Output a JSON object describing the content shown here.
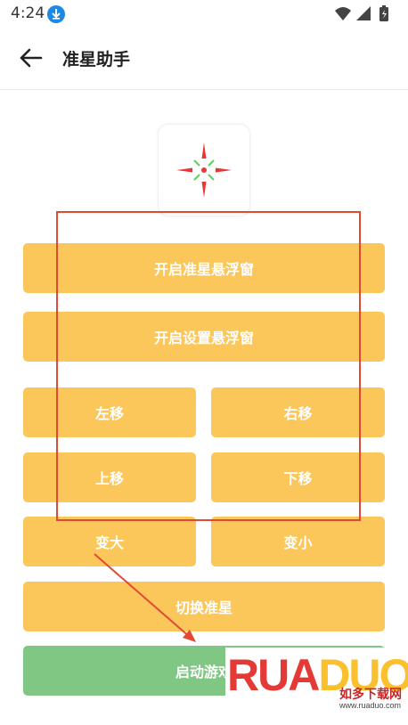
{
  "status_bar": {
    "time": "4:24"
  },
  "app_bar": {
    "title": "准星助手"
  },
  "buttons": {
    "open_crosshair_float": "开启准星悬浮窗",
    "open_settings_float": "开启设置悬浮窗",
    "move_left": "左移",
    "move_right": "右移",
    "move_up": "上移",
    "move_down": "下移",
    "enlarge": "变大",
    "shrink": "变小",
    "switch_crosshair": "切换准星",
    "launch_game": "启动游戏"
  },
  "watermark": {
    "logo_main": "RUA",
    "logo_tail": "DUO",
    "subtitle": "如多下载网",
    "url": "www.ruaduo.com"
  },
  "colors": {
    "button": "#fbc65a",
    "launch_button": "#81c784",
    "annotation": "#e04a35",
    "status_icon": "#1e88e5"
  }
}
